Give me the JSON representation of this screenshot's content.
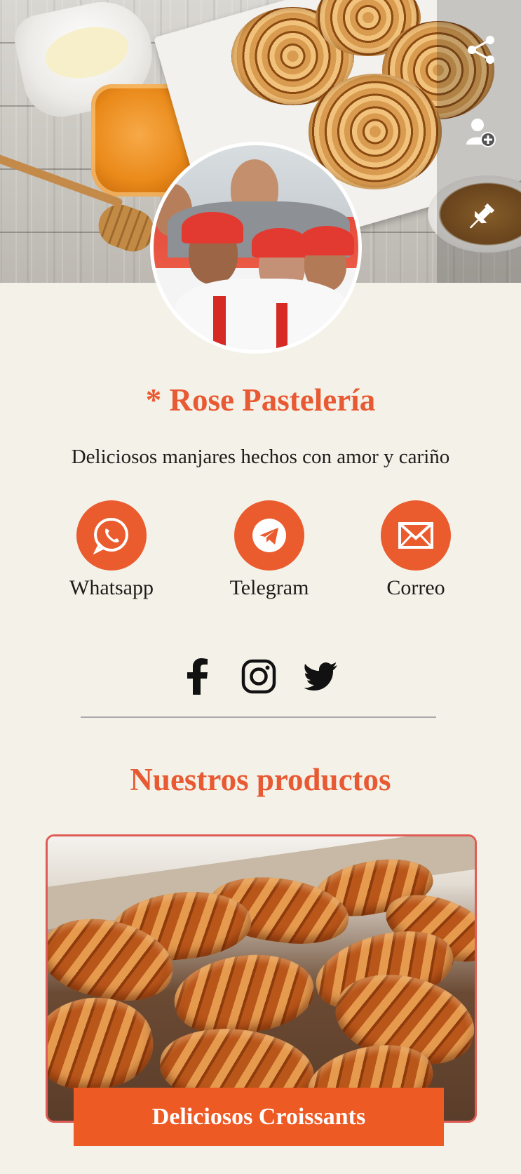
{
  "header": {
    "cover_photo": "pastries-cover-image",
    "actions": [
      {
        "icon": "share-icon"
      },
      {
        "icon": "add-contact-icon"
      },
      {
        "icon": "pin-icon"
      }
    ]
  },
  "profile": {
    "avatar": "team-photo",
    "title": "* Rose Pastelería",
    "tagline": "Deliciosos manjares hechos con amor y cariño"
  },
  "contacts": [
    {
      "label": "Whatsapp",
      "icon": "whatsapp-icon"
    },
    {
      "label": "Telegram",
      "icon": "telegram-icon"
    },
    {
      "label": "Correo",
      "icon": "mail-icon"
    }
  ],
  "social": [
    {
      "icon": "facebook-icon"
    },
    {
      "icon": "instagram-icon"
    },
    {
      "icon": "twitter-icon"
    }
  ],
  "products": {
    "title": "Nuestros productos",
    "items": [
      {
        "label": "Deliciosos Croissants",
        "image": "croissants-image"
      }
    ]
  },
  "colors": {
    "accent": "#ea5b2e",
    "background": "#f4f2e8",
    "text": "#1c1c1c"
  }
}
